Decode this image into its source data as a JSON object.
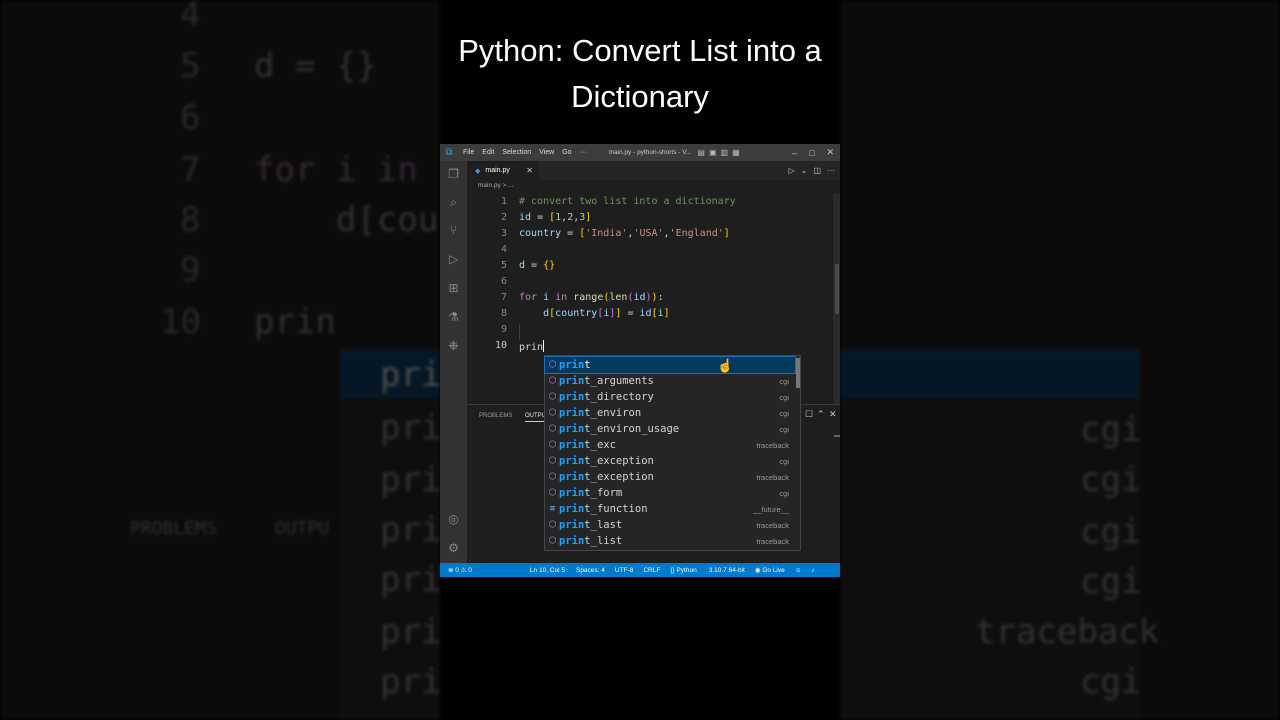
{
  "title": "Python: Convert List into a Dictionary",
  "window": {
    "title": "main.py - python-shorts - V...",
    "menu": [
      "File",
      "Edit",
      "Selection",
      "View",
      "Go",
      "···"
    ]
  },
  "tab": {
    "label": "main.py"
  },
  "breadcrumb": "main.py > ...",
  "code_lines": [
    {
      "n": "1",
      "text": "# convert two list into a dictionary"
    },
    {
      "n": "2",
      "text": "id = [1,2,3]"
    },
    {
      "n": "3",
      "text": "country = ['India','USA','England']"
    },
    {
      "n": "4",
      "text": ""
    },
    {
      "n": "5",
      "text": "d = {}"
    },
    {
      "n": "6",
      "text": ""
    },
    {
      "n": "7",
      "text": "for i in range(len(id)):"
    },
    {
      "n": "8",
      "text": "    d[country[i]] = id[i]"
    },
    {
      "n": "9",
      "text": ""
    },
    {
      "n": "10",
      "text": "prin"
    }
  ],
  "panel": {
    "tabs": [
      "PROBLEMS",
      "OUTPUT"
    ]
  },
  "suggestions": [
    {
      "label": "print",
      "detail": ""
    },
    {
      "label": "print_arguments",
      "detail": "cgi"
    },
    {
      "label": "print_directory",
      "detail": "cgi"
    },
    {
      "label": "print_environ",
      "detail": "cgi"
    },
    {
      "label": "print_environ_usage",
      "detail": "cgi"
    },
    {
      "label": "print_exc",
      "detail": "traceback"
    },
    {
      "label": "print_exception",
      "detail": "cgi"
    },
    {
      "label": "print_exception",
      "detail": "traceback"
    },
    {
      "label": "print_form",
      "detail": "cgi"
    },
    {
      "label": "print_function",
      "detail": "__future__"
    },
    {
      "label": "print_last",
      "detail": "traceback"
    },
    {
      "label": "print_list",
      "detail": "traceback"
    }
  ],
  "status": {
    "problems": "⊗ 0 ⚠ 0",
    "position": "Ln 10, Col 5",
    "spaces": "Spaces: 4",
    "encoding": "UTF-8",
    "eol": "CRLF",
    "language": "Python",
    "interpreter": "3.10.7 64-bit",
    "golive": "Go Live"
  },
  "colors": {
    "accent": "#007acc",
    "editor_bg": "#1e1e1e",
    "suggest_selected": "#04395e"
  }
}
